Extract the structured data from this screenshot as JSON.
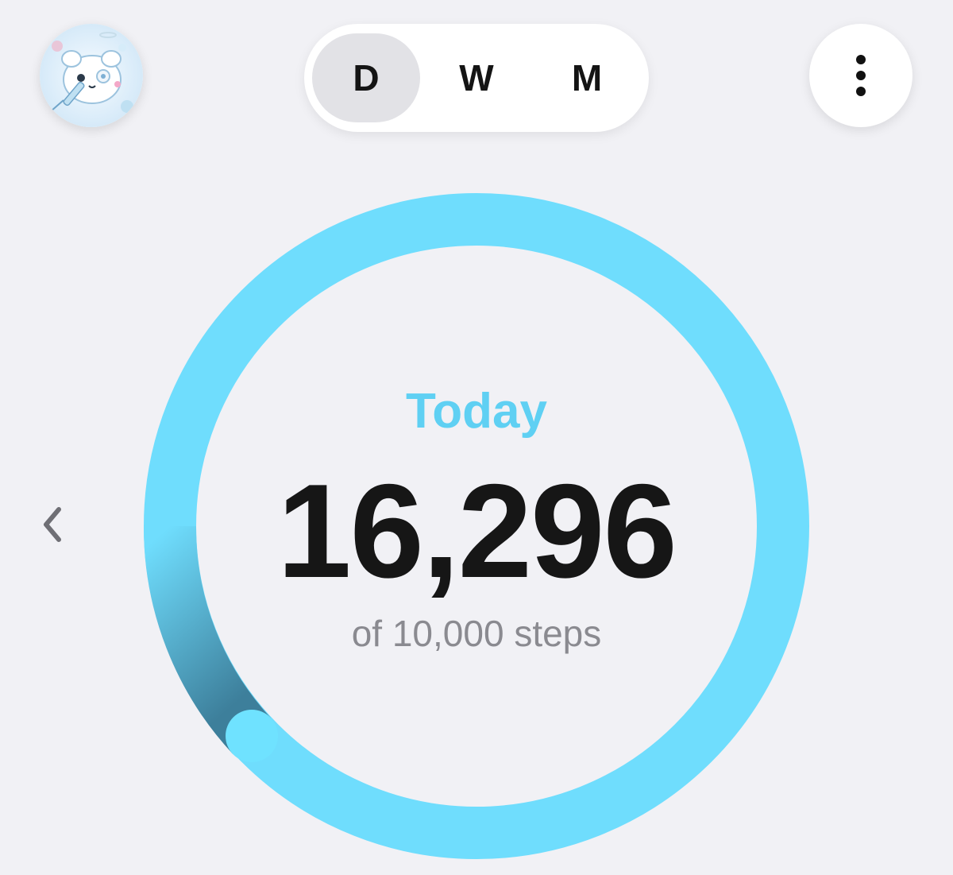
{
  "header": {
    "range_tabs": [
      {
        "label": "D",
        "active": true
      },
      {
        "label": "W",
        "active": false
      },
      {
        "label": "M",
        "active": false
      }
    ]
  },
  "summary": {
    "period_label": "Today",
    "steps_value": "16,296",
    "goal_label": "of 10,000 steps",
    "progress_fraction": 1.63
  },
  "colors": {
    "accent": "#5fd0f3",
    "ring": "#6fddfd",
    "ring_dark": "#3d8aa6",
    "background": "#f1f1f5"
  },
  "icons": {
    "avatar": "profile-avatar",
    "more": "more-vertical-icon",
    "previous": "chevron-left-icon"
  }
}
